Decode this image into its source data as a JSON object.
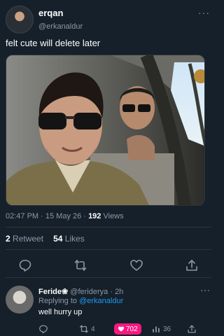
{
  "tweet": {
    "display_name": "erqan",
    "handle": "@erkanaldur",
    "text": "felt cute will delete later",
    "time": "02:47 PM",
    "date": "15 May 26",
    "views_count": "192",
    "views_label": "Views",
    "retweets_count": "2",
    "retweets_label": "Retweet",
    "likes_count": "54",
    "likes_label": "Likes"
  },
  "icons": {
    "more": "more-icon",
    "reply": "reply-icon",
    "retweet": "retweet-icon",
    "like": "heart-icon",
    "share": "share-icon",
    "views": "views-icon"
  },
  "reply": {
    "display_name": "Feride",
    "name_emoji": "❀",
    "handle": "@feriderya",
    "time": "2h",
    "replying_prefix": "Replying to",
    "replying_handle": "@erkanaldur",
    "text": "well hurry up",
    "retweets": "4",
    "likes": "702",
    "views": "36"
  },
  "colors": {
    "background": "#15202b",
    "accent": "#1d9bf0",
    "like_pink": "#f91880",
    "muted_text": "#8b98a5"
  }
}
